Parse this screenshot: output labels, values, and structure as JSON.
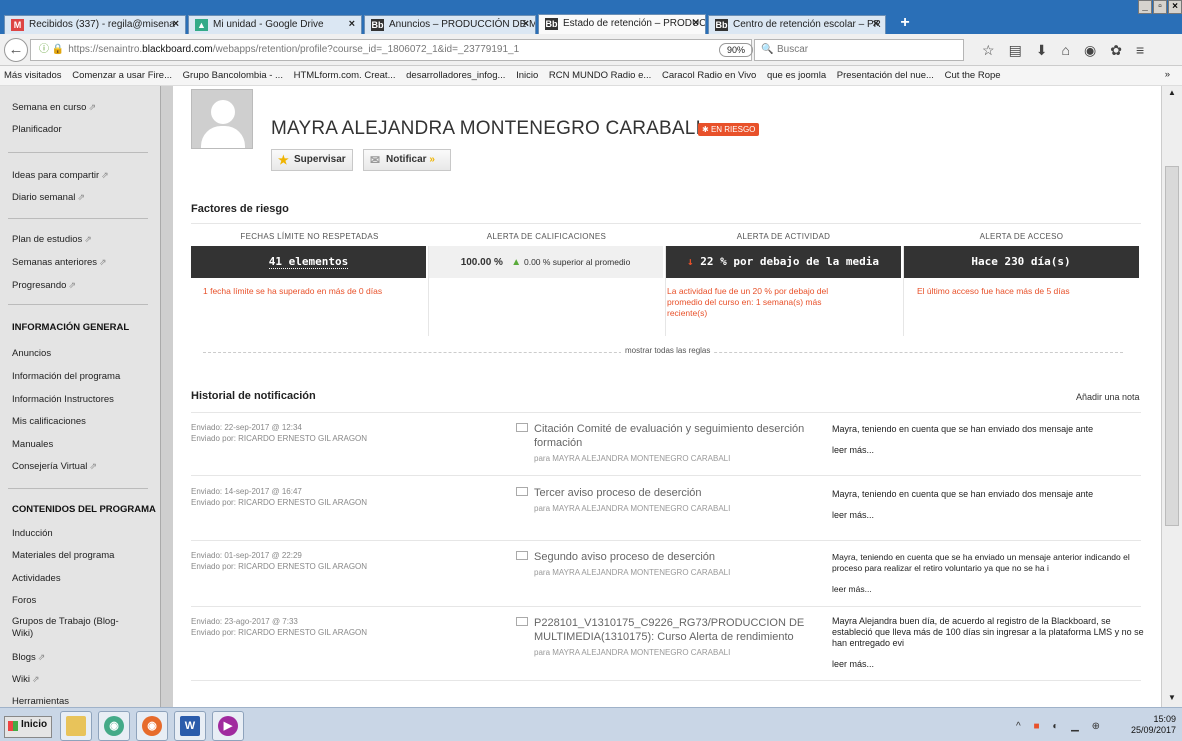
{
  "tabs": [
    {
      "icon": "gmail-icon",
      "label": "Recibidos (337) - regila@misena"
    },
    {
      "icon": "drive-icon",
      "label": "Mi unidad - Google Drive"
    },
    {
      "icon": "blackboard-icon",
      "label": "Anuncios – PRODUCCIÓN DE MU"
    },
    {
      "icon": "blackboard-icon",
      "label": "Estado de retención – PRODUC"
    },
    {
      "icon": "blackboard-icon",
      "label": "Centro de retención escolar – PR"
    }
  ],
  "nav": {
    "url_prefix": "https://senaintro.",
    "url_domain": "blackboard.com",
    "url_rest": "/webapps/retention/profile?course_id=_1806072_1&id=_23779191_1",
    "zoom": "90%",
    "search_placeholder": "Buscar"
  },
  "bookmarks": [
    "Más visitados",
    "Comenzar a usar Fire...",
    "Grupo Bancolombia - ...",
    "HTMLform.com. Creat...",
    "desarrolladores_infog...",
    "Inicio",
    "RCN MUNDO Radio e...",
    "Caracol Radio en Vivo",
    "que es joomla",
    "Presentación del nue...",
    "Cut the Rope"
  ],
  "sidebar": {
    "items_top": [
      "Semana en curso",
      "Planificador"
    ],
    "items_mid": [
      "Ideas para compartir",
      "Diario semanal"
    ],
    "items_plan": [
      "Plan de estudios",
      "Semanas anteriores",
      "Progresando"
    ],
    "heading_info": "INFORMACIÓN GENERAL",
    "items_info": [
      "Anuncios",
      "Información del programa",
      "Información Instructores",
      "Mis calificaciones",
      "Manuales",
      "Consejería Virtual"
    ],
    "heading_content": "CONTENIDOS DEL PROGRAMA",
    "items_content": [
      "Inducción",
      "Materiales del programa",
      "Actividades",
      "Foros",
      "Grupos de Trabajo (Blog-",
      "Wiki)",
      "Blogs",
      "Wiki",
      "Herramientas"
    ]
  },
  "profile": {
    "name": "MAYRA ALEJANDRA MONTENEGRO CARABALI",
    "badge": "EN RIESGO",
    "supervise": "Supervisar",
    "notify": "Notificar"
  },
  "risk": {
    "title": "Factores de riesgo",
    "col1_head": "FECHAS LÍMITE NO RESPETADAS",
    "col2_head": "ALERTA DE CALIFICACIONES",
    "col3_head": "ALERTA DE ACTIVIDAD",
    "col4_head": "ALERTA DE ACCESO",
    "col1_value": "41 elementos",
    "col2_value": "100.00 %",
    "col2_note": "0.00 % superior al promedio",
    "col3_value": "22 % por debajo de la media",
    "col4_value": "Hace 230 día(s)",
    "col1_text": "1 fecha límite se ha superado en más de 0 días",
    "col3_text_1": "La actividad fue de un 20 % por debajo del",
    "col3_text_2": "promedio del curso en: 1 semana(s) más",
    "col3_text_3": "reciente(s)",
    "col4_text": "El último acceso fue hace más de 5 días",
    "show_rules": "mostrar todas las reglas"
  },
  "history": {
    "title": "Historial de notificación",
    "add_note": "Añadir una nota",
    "rows": [
      {
        "sent": "Enviado: 22-sep-2017 @ 12:34",
        "by": "Enviado por: RICARDO ERNESTO GIL ARAGON",
        "subject": "Citación Comité de evaluación y seguimiento deserción formación",
        "to": "para MAYRA ALEJANDRA MONTENEGRO CARABALI",
        "msg": "Mayra, teniendo en cuenta que se han enviado dos mensaje ante",
        "more": "leer más..."
      },
      {
        "sent": "Enviado: 14-sep-2017 @ 16:47",
        "by": "Enviado por: RICARDO ERNESTO GIL ARAGON",
        "subject": "Tercer aviso proceso de deserción",
        "to": "para MAYRA ALEJANDRA MONTENEGRO CARABALI",
        "msg": "Mayra, teniendo en cuenta que se han enviado dos mensaje ante",
        "more": "leer más..."
      },
      {
        "sent": "Enviado: 01-sep-2017 @ 22:29",
        "by": "Enviado por: RICARDO ERNESTO GIL ARAGON",
        "subject": "Segundo aviso proceso de deserción",
        "to": "para MAYRA ALEJANDRA MONTENEGRO CARABALI",
        "msg": "Mayra, teniendo en cuenta que se ha enviado un mensaje anterior indicando el proceso para realizar el retiro voluntario ya que no se ha i",
        "more": "leer más..."
      },
      {
        "sent": "Enviado: 23-ago-2017 @ 7:33",
        "by": "Enviado por: RICARDO ERNESTO GIL ARAGON",
        "subject": "P228101_V1310175_C9226_RG73/PRODUCCION DE MULTIMEDIA(1310175): Curso Alerta de rendimiento",
        "to": "para MAYRA ALEJANDRA MONTENEGRO CARABALI",
        "msg": "Mayra Alejandra buen día, de acuerdo al registro de la Blackboard, se estableció que lleva más de 100 días sin ingresar a la plataforma LMS y no se han entregado evi",
        "more": "leer más..."
      }
    ]
  },
  "taskbar": {
    "start": "Inicio",
    "time": "15:09",
    "date": "25/09/2017"
  },
  "colors": {
    "accent_risk": "#e8512a",
    "dark_cell": "#333333",
    "tab_blue": "#2a6fb7"
  }
}
